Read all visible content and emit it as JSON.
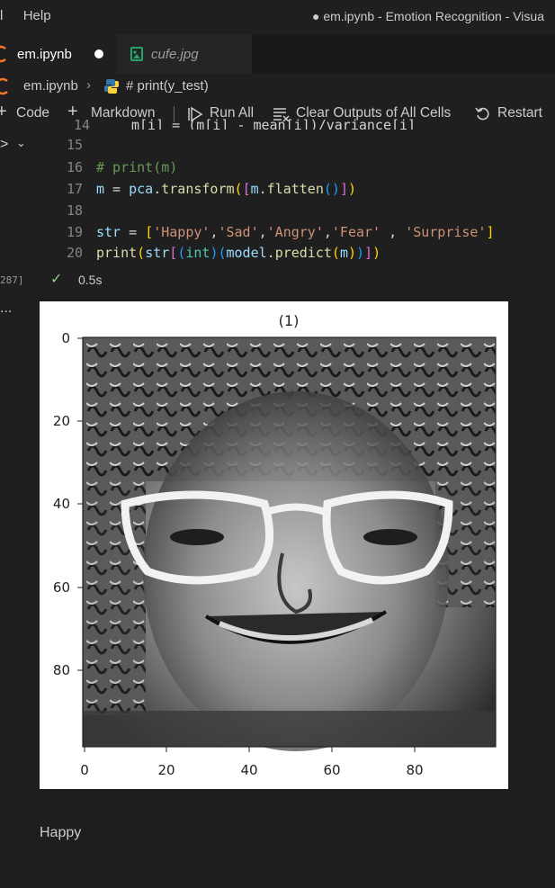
{
  "titlebar": {
    "menu_fragment": "l",
    "menu_help": "Help",
    "window_title": "● em.ipynb - Emotion Recognition - Visua"
  },
  "tabs": [
    {
      "label": "em.ipynb",
      "modified": true,
      "active": true
    },
    {
      "label": "cufe.jpg",
      "modified": false,
      "active": false
    }
  ],
  "breadcrumb": {
    "file": "em.ipynb",
    "cell": "# print(y_test)"
  },
  "toolbar": {
    "code": "Code",
    "markdown": "Markdown",
    "run_all": "Run All",
    "clear_outputs": "Clear Outputs of All Cells",
    "restart": "Restart"
  },
  "cell": {
    "execution_count": "287]",
    "status": "0.5s",
    "lines": [
      {
        "n": "14",
        "text": "m[i] = (m[i] - mean[i])/variance[i]"
      },
      {
        "n": "15",
        "text": ""
      },
      {
        "n": "16",
        "text": "# print(m)"
      },
      {
        "n": "17",
        "text": "m = pca.transform([m.flatten()])"
      },
      {
        "n": "18",
        "text": ""
      },
      {
        "n": "19",
        "text": "str = ['Happy','Sad','Angry','Fear' , 'Surprise']"
      },
      {
        "n": "20",
        "text": "print(str[(int)(model.predict(m))])"
      }
    ]
  },
  "output": {
    "ellipsis": "...",
    "plot_title": "(1)",
    "y_ticks": [
      "0",
      "20",
      "40",
      "60",
      "80"
    ],
    "x_ticks": [
      "0",
      "20",
      "40",
      "60",
      "80"
    ],
    "image_alt": "grayscale face image",
    "printed_result": "Happy"
  },
  "colors": {
    "accent": "#007acc",
    "background": "#1e1e1e"
  }
}
